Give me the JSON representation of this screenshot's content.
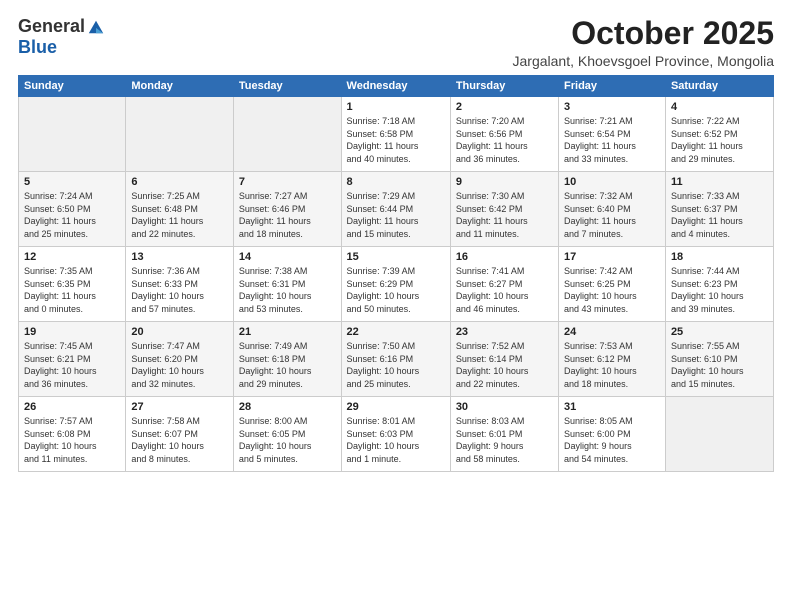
{
  "header": {
    "logo_general": "General",
    "logo_blue": "Blue",
    "month_title": "October 2025",
    "subtitle": "Jargalant, Khoevsgoel Province, Mongolia"
  },
  "days_of_week": [
    "Sunday",
    "Monday",
    "Tuesday",
    "Wednesday",
    "Thursday",
    "Friday",
    "Saturday"
  ],
  "weeks": [
    [
      {
        "day": "",
        "info": ""
      },
      {
        "day": "",
        "info": ""
      },
      {
        "day": "",
        "info": ""
      },
      {
        "day": "1",
        "info": "Sunrise: 7:18 AM\nSunset: 6:58 PM\nDaylight: 11 hours\nand 40 minutes."
      },
      {
        "day": "2",
        "info": "Sunrise: 7:20 AM\nSunset: 6:56 PM\nDaylight: 11 hours\nand 36 minutes."
      },
      {
        "day": "3",
        "info": "Sunrise: 7:21 AM\nSunset: 6:54 PM\nDaylight: 11 hours\nand 33 minutes."
      },
      {
        "day": "4",
        "info": "Sunrise: 7:22 AM\nSunset: 6:52 PM\nDaylight: 11 hours\nand 29 minutes."
      }
    ],
    [
      {
        "day": "5",
        "info": "Sunrise: 7:24 AM\nSunset: 6:50 PM\nDaylight: 11 hours\nand 25 minutes."
      },
      {
        "day": "6",
        "info": "Sunrise: 7:25 AM\nSunset: 6:48 PM\nDaylight: 11 hours\nand 22 minutes."
      },
      {
        "day": "7",
        "info": "Sunrise: 7:27 AM\nSunset: 6:46 PM\nDaylight: 11 hours\nand 18 minutes."
      },
      {
        "day": "8",
        "info": "Sunrise: 7:29 AM\nSunset: 6:44 PM\nDaylight: 11 hours\nand 15 minutes."
      },
      {
        "day": "9",
        "info": "Sunrise: 7:30 AM\nSunset: 6:42 PM\nDaylight: 11 hours\nand 11 minutes."
      },
      {
        "day": "10",
        "info": "Sunrise: 7:32 AM\nSunset: 6:40 PM\nDaylight: 11 hours\nand 7 minutes."
      },
      {
        "day": "11",
        "info": "Sunrise: 7:33 AM\nSunset: 6:37 PM\nDaylight: 11 hours\nand 4 minutes."
      }
    ],
    [
      {
        "day": "12",
        "info": "Sunrise: 7:35 AM\nSunset: 6:35 PM\nDaylight: 11 hours\nand 0 minutes."
      },
      {
        "day": "13",
        "info": "Sunrise: 7:36 AM\nSunset: 6:33 PM\nDaylight: 10 hours\nand 57 minutes."
      },
      {
        "day": "14",
        "info": "Sunrise: 7:38 AM\nSunset: 6:31 PM\nDaylight: 10 hours\nand 53 minutes."
      },
      {
        "day": "15",
        "info": "Sunrise: 7:39 AM\nSunset: 6:29 PM\nDaylight: 10 hours\nand 50 minutes."
      },
      {
        "day": "16",
        "info": "Sunrise: 7:41 AM\nSunset: 6:27 PM\nDaylight: 10 hours\nand 46 minutes."
      },
      {
        "day": "17",
        "info": "Sunrise: 7:42 AM\nSunset: 6:25 PM\nDaylight: 10 hours\nand 43 minutes."
      },
      {
        "day": "18",
        "info": "Sunrise: 7:44 AM\nSunset: 6:23 PM\nDaylight: 10 hours\nand 39 minutes."
      }
    ],
    [
      {
        "day": "19",
        "info": "Sunrise: 7:45 AM\nSunset: 6:21 PM\nDaylight: 10 hours\nand 36 minutes."
      },
      {
        "day": "20",
        "info": "Sunrise: 7:47 AM\nSunset: 6:20 PM\nDaylight: 10 hours\nand 32 minutes."
      },
      {
        "day": "21",
        "info": "Sunrise: 7:49 AM\nSunset: 6:18 PM\nDaylight: 10 hours\nand 29 minutes."
      },
      {
        "day": "22",
        "info": "Sunrise: 7:50 AM\nSunset: 6:16 PM\nDaylight: 10 hours\nand 25 minutes."
      },
      {
        "day": "23",
        "info": "Sunrise: 7:52 AM\nSunset: 6:14 PM\nDaylight: 10 hours\nand 22 minutes."
      },
      {
        "day": "24",
        "info": "Sunrise: 7:53 AM\nSunset: 6:12 PM\nDaylight: 10 hours\nand 18 minutes."
      },
      {
        "day": "25",
        "info": "Sunrise: 7:55 AM\nSunset: 6:10 PM\nDaylight: 10 hours\nand 15 minutes."
      }
    ],
    [
      {
        "day": "26",
        "info": "Sunrise: 7:57 AM\nSunset: 6:08 PM\nDaylight: 10 hours\nand 11 minutes."
      },
      {
        "day": "27",
        "info": "Sunrise: 7:58 AM\nSunset: 6:07 PM\nDaylight: 10 hours\nand 8 minutes."
      },
      {
        "day": "28",
        "info": "Sunrise: 8:00 AM\nSunset: 6:05 PM\nDaylight: 10 hours\nand 5 minutes."
      },
      {
        "day": "29",
        "info": "Sunrise: 8:01 AM\nSunset: 6:03 PM\nDaylight: 10 hours\nand 1 minute."
      },
      {
        "day": "30",
        "info": "Sunrise: 8:03 AM\nSunset: 6:01 PM\nDaylight: 9 hours\nand 58 minutes."
      },
      {
        "day": "31",
        "info": "Sunrise: 8:05 AM\nSunset: 6:00 PM\nDaylight: 9 hours\nand 54 minutes."
      },
      {
        "day": "",
        "info": ""
      }
    ]
  ]
}
